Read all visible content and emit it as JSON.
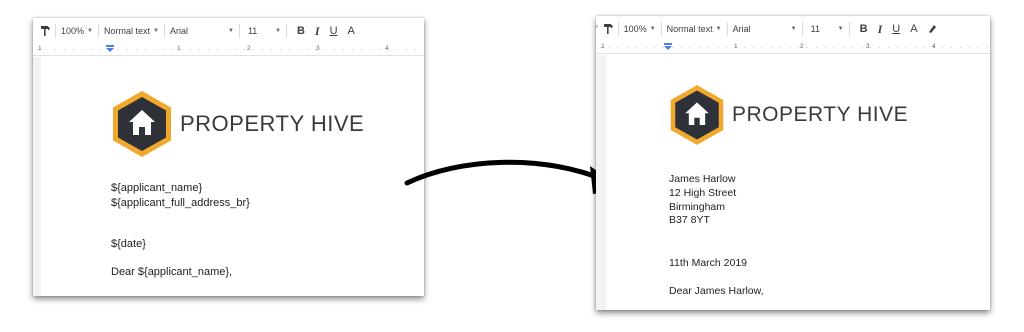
{
  "toolbar": {
    "zoom": "100%",
    "style": "Normal text",
    "font": "Arial",
    "size": "11",
    "bold": "B",
    "italic": "I",
    "underline": "U",
    "text_color": "A"
  },
  "ruler": {
    "nums": [
      "1",
      "1",
      "2",
      "3",
      "4"
    ]
  },
  "brand": {
    "name": "PROPERTY HIVE",
    "hex_outer": "#f0a92d",
    "hex_inner": "#2e3138"
  },
  "template_doc": {
    "name_line": "${applicant_name}",
    "address_line": "${applicant_full_address_br}",
    "date_line": "${date}",
    "greeting": "Dear ${applicant_name},"
  },
  "merged_doc": {
    "name_line": "James Harlow",
    "address_1": "12 High Street",
    "address_2": "Birmingham",
    "address_3": "B37 8YT",
    "date_line": "11th March 2019",
    "greeting": "Dear James Harlow,"
  }
}
